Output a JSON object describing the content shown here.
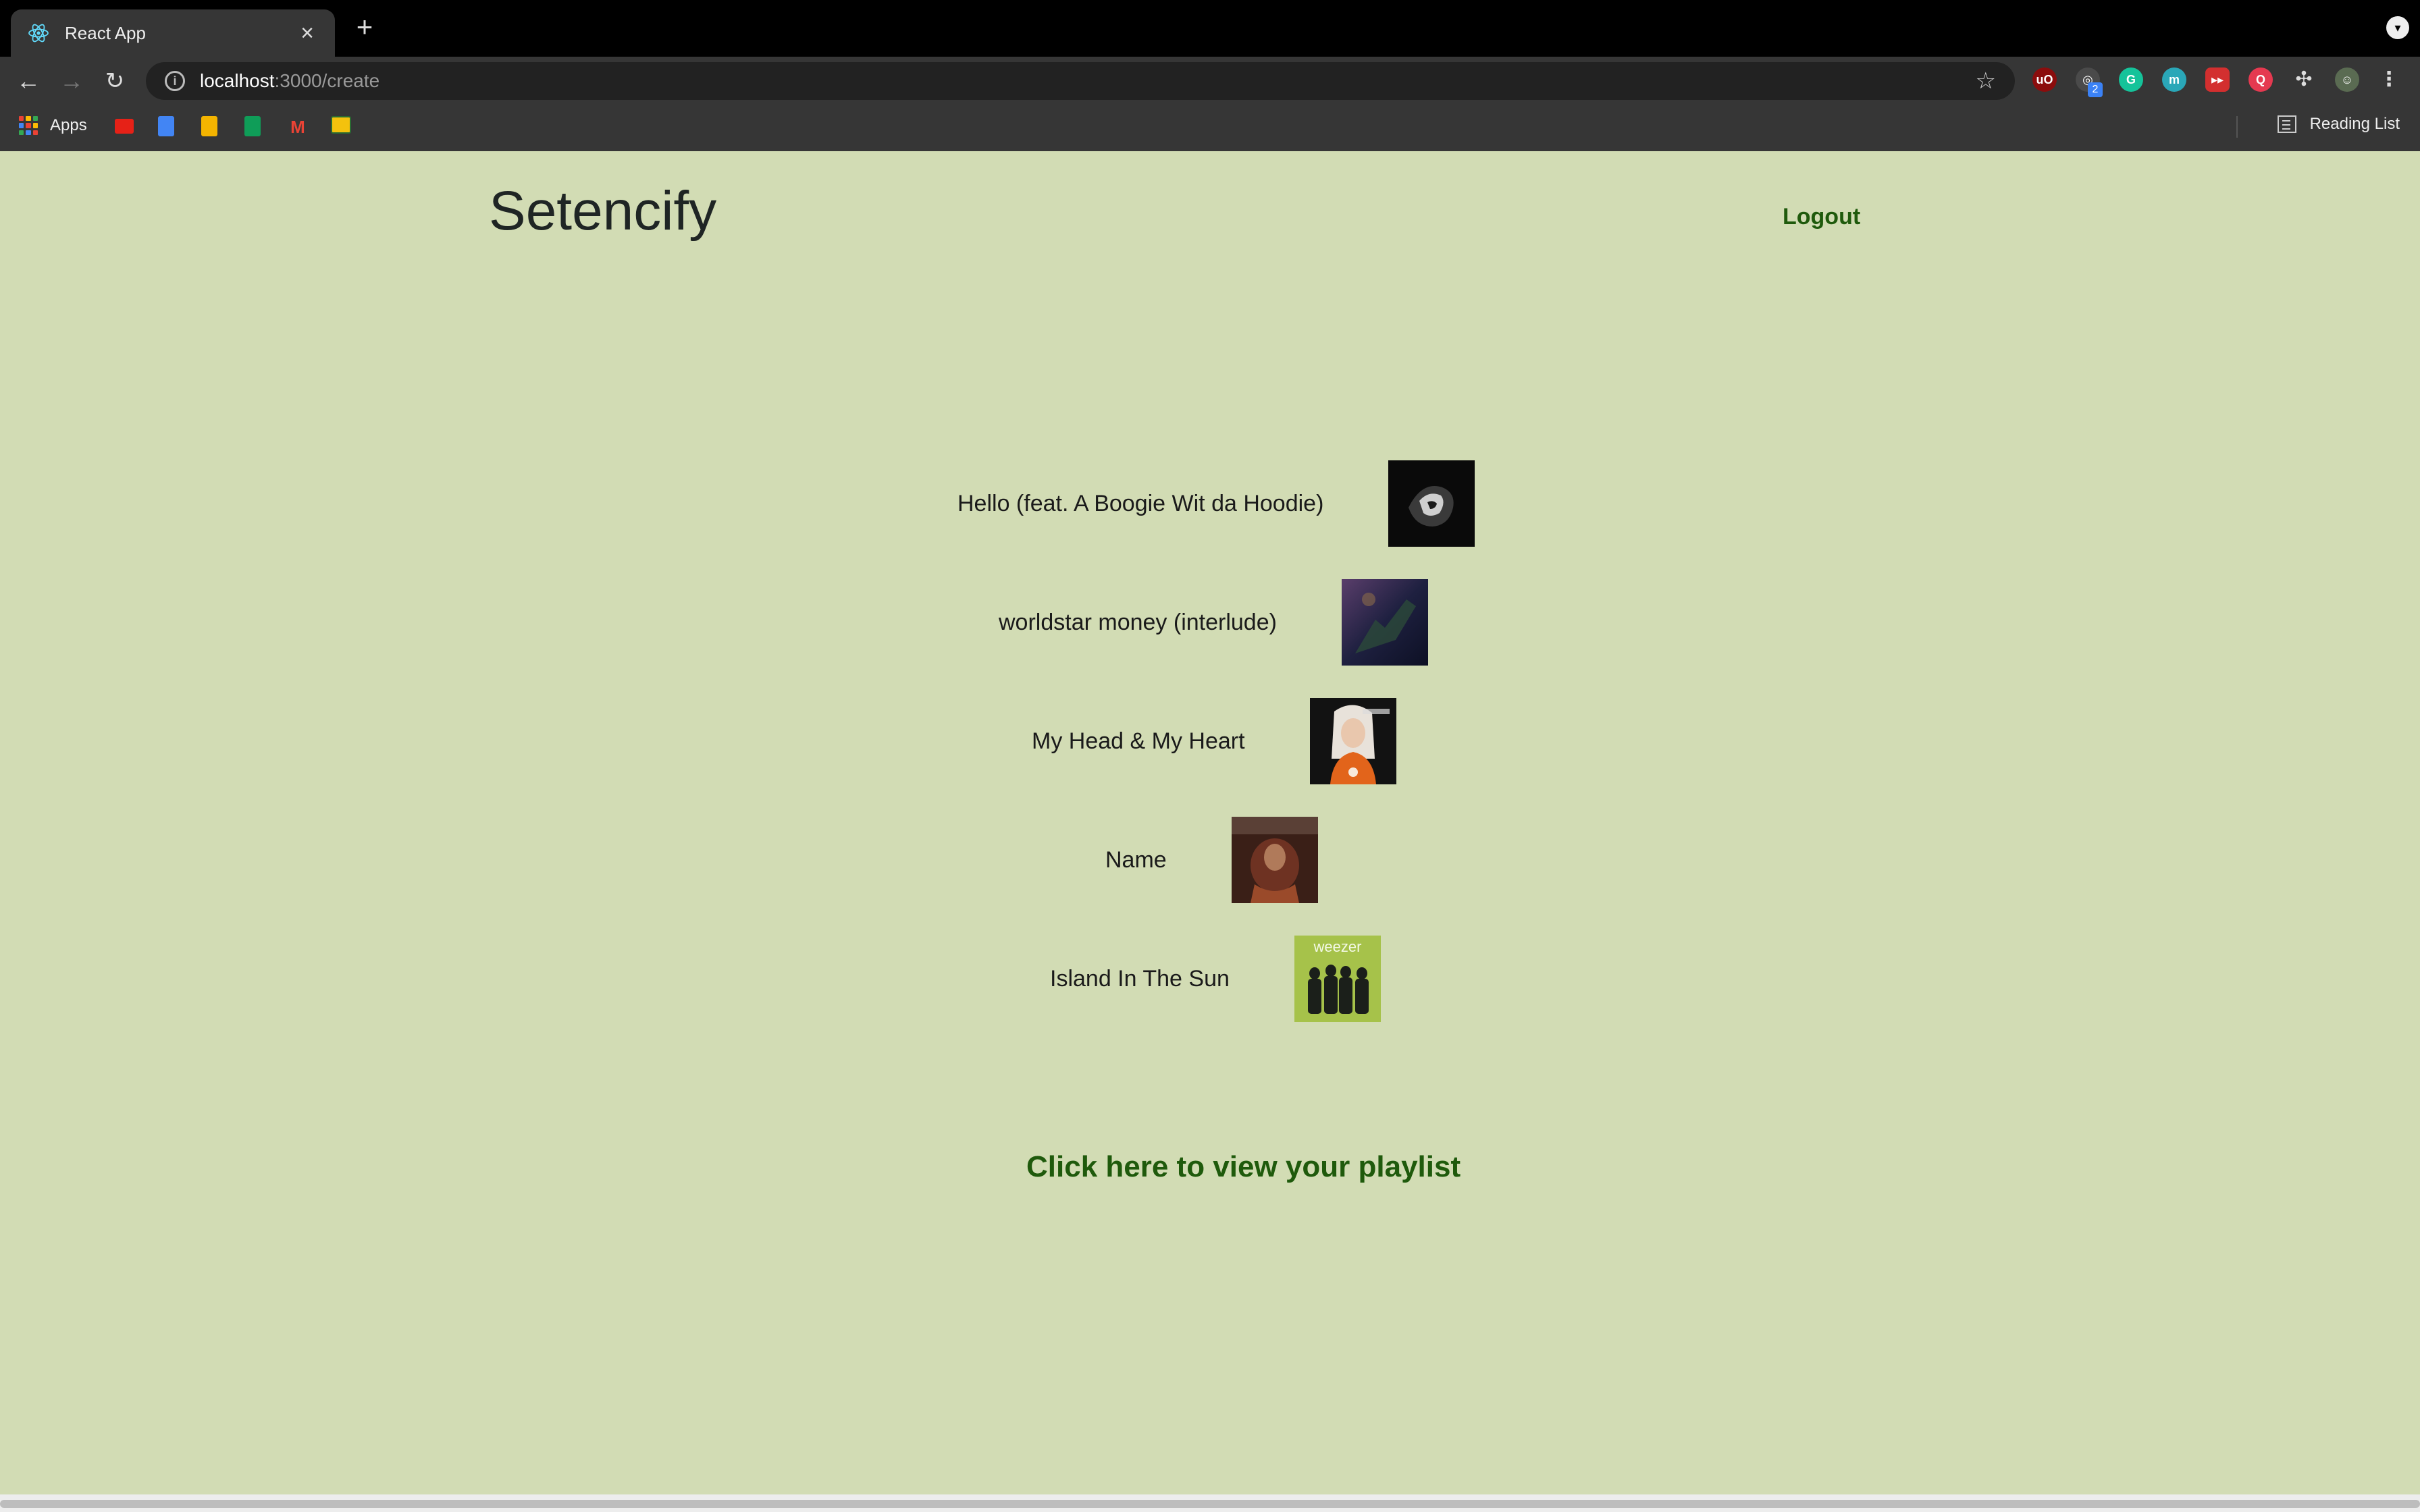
{
  "browser": {
    "tab_title": "React App",
    "url_host": "localhost",
    "url_path": ":3000/create",
    "bookmarks_apps_label": "Apps",
    "reading_list_label": "Reading List",
    "extension_badge": "2"
  },
  "header": {
    "brand": "Setencify",
    "logout_label": "Logout"
  },
  "tracks": [
    {
      "name": "Hello (feat. A Boogie Wit da Hoodie)",
      "art_icon": "album-art-dark-figure"
    },
    {
      "name": "worldstar money (interlude)",
      "art_icon": "album-art-night-sky"
    },
    {
      "name": "My Head & My Heart",
      "art_icon": "album-art-portrait-orange"
    },
    {
      "name": "Name",
      "art_icon": "album-art-dark-red"
    },
    {
      "name": "Island In The Sun",
      "art_icon": "album-art-weezer-green",
      "art_text": "weezer"
    }
  ],
  "playlist_link": "Click here to view your playlist",
  "colors": {
    "page_background": "#d2dcb4",
    "link_green": "#1f5a0c",
    "brand_text": "#1f2524"
  }
}
